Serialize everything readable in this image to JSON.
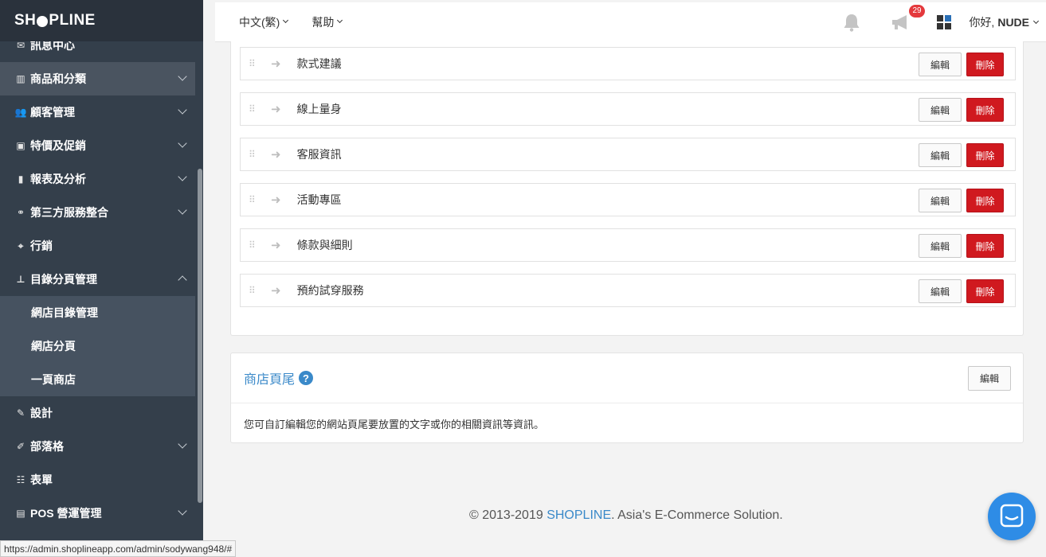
{
  "brand": {
    "logo_pre": "SH",
    "logo_post": "PLINE"
  },
  "sidebar": {
    "items": [
      {
        "label": "訊息中心",
        "icon": "envelope-icon",
        "glyph": "✉",
        "chevron": ""
      },
      {
        "label": "商品和分類",
        "icon": "barcode-icon",
        "glyph": "▥",
        "chevron": "down"
      },
      {
        "label": "顧客管理",
        "icon": "users-icon",
        "glyph": "👥",
        "chevron": "down"
      },
      {
        "label": "特價及促銷",
        "icon": "money-icon",
        "glyph": "▣",
        "chevron": "down"
      },
      {
        "label": "報表及分析",
        "icon": "bar-chart-icon",
        "glyph": "▮",
        "chevron": "down"
      },
      {
        "label": "第三方服務整合",
        "icon": "link-icon",
        "glyph": "⚭",
        "chevron": "down"
      },
      {
        "label": "行銷",
        "icon": "crosshair-icon",
        "glyph": "⌖",
        "chevron": ""
      },
      {
        "label": "目錄分頁管理",
        "icon": "sitemap-icon",
        "glyph": "⊥",
        "chevron": "up"
      }
    ],
    "subitems": [
      {
        "label": "網店目錄管理"
      },
      {
        "label": "網店分頁"
      },
      {
        "label": "一頁商店"
      }
    ],
    "items_after": [
      {
        "label": "設計",
        "icon": "magic-wand-icon",
        "glyph": "✎",
        "chevron": ""
      },
      {
        "label": "部落格",
        "icon": "edit-icon",
        "glyph": "✐",
        "chevron": "down"
      },
      {
        "label": "表單",
        "icon": "form-icon",
        "glyph": "☷",
        "chevron": ""
      },
      {
        "label": "POS 營運管理",
        "icon": "pos-icon",
        "glyph": "▤",
        "chevron": "down"
      }
    ]
  },
  "topbar": {
    "language": "中文(繁)",
    "help": "幫助",
    "notification_count": "29",
    "greeting": "你好,",
    "username": "NUDE"
  },
  "pages": [
    {
      "label": "款式建議",
      "edit": "編輯",
      "delete": "刪除"
    },
    {
      "label": "線上量身",
      "edit": "編輯",
      "delete": "刪除"
    },
    {
      "label": "客服資訊",
      "edit": "編輯",
      "delete": "刪除"
    },
    {
      "label": "活動專區",
      "edit": "編輯",
      "delete": "刪除"
    },
    {
      "label": "條款與細則",
      "edit": "編輯",
      "delete": "刪除"
    },
    {
      "label": "預約試穿服務",
      "edit": "編輯",
      "delete": "刪除"
    }
  ],
  "footer_card": {
    "title": "商店頁尾",
    "edit": "編輯",
    "description": "您可自訂編輯您的網站頁尾要放置的文字或你的相關資訊等資訊。"
  },
  "copyright": {
    "prefix": "© 2013-2019 ",
    "brand": "SHOPLINE",
    "suffix": ". Asia's E-Commerce Solution."
  },
  "status_url": "https://admin.shoplineapp.com/admin/sodywang948/#"
}
